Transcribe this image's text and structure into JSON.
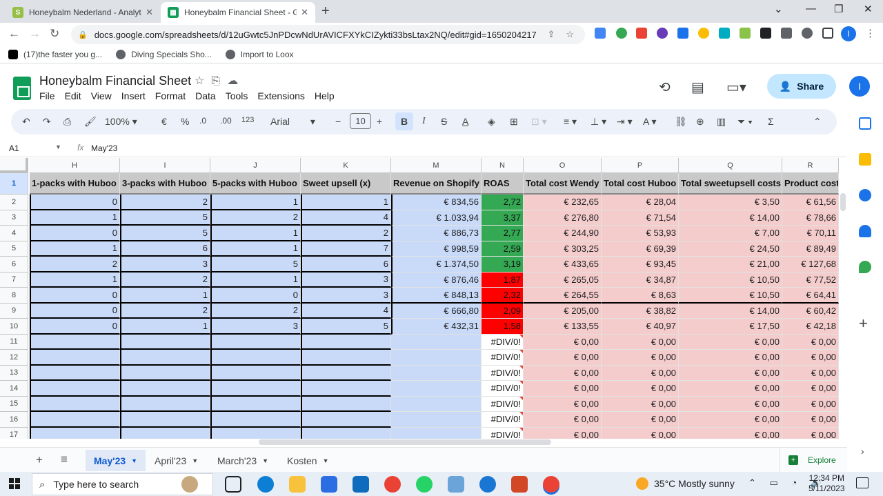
{
  "browser": {
    "tabs": [
      {
        "title": "Honeybalm Nederland - Analytics",
        "close": "✕"
      },
      {
        "title": "Honeybalm Financial Sheet - Google Sheets",
        "close": "✕"
      }
    ],
    "new_tab": "+",
    "url": "docs.google.com/spreadsheets/d/12uGwtc5JnPDcwNdUrAVICFXYkCIZykti33bsLtax2NQ/edit#gid=1650204217",
    "profile_initial": "I",
    "bookmarks": [
      "(17)the faster you g...",
      "Diving Specials Sho...",
      "Import to Loox"
    ]
  },
  "sheets": {
    "title": "Honeybalm Financial Sheet",
    "menus": [
      "File",
      "Edit",
      "View",
      "Insert",
      "Format",
      "Data",
      "Tools",
      "Extensions",
      "Help"
    ],
    "share_label": "Share",
    "account_initial": "I",
    "toolbar": {
      "zoom": "100%",
      "currency": "€",
      "percent": "%",
      "dec_decrease": ".0",
      "dec_increase": ".00",
      "number_format": "123",
      "font": "Arial",
      "font_size": "10",
      "bold": "B",
      "italic": "I"
    },
    "formula_bar": {
      "cell_ref": "A1",
      "fx": "fx",
      "value": "May'23"
    },
    "columns": [
      "H",
      "I",
      "J",
      "K",
      "M",
      "N",
      "O",
      "P",
      "Q",
      "R"
    ],
    "row_numbers": [
      "1",
      "2",
      "3",
      "4",
      "5",
      "6",
      "7",
      "8",
      "9",
      "10",
      "11",
      "12",
      "13",
      "14",
      "15",
      "16",
      "17"
    ],
    "headers": [
      "1-packs with Huboo",
      "3-packs with Huboo",
      "5-packs with Huboo",
      "Sweet upsell (x)",
      "Revenue on Shopify",
      "ROAS",
      "Total cost Wendy",
      "Total cost Huboo",
      "Total sweetupsell costs",
      "Product cost"
    ],
    "rows": [
      [
        "0",
        "2",
        "1",
        "1",
        "€ 834,56",
        "2,72",
        "€ 232,65",
        "€ 28,04",
        "€ 3,50",
        "€ 61,56"
      ],
      [
        "1",
        "5",
        "2",
        "4",
        "€ 1.033,94",
        "3,37",
        "€ 276,80",
        "€ 71,54",
        "€ 14,00",
        "€ 78,66"
      ],
      [
        "0",
        "5",
        "1",
        "2",
        "€ 886,73",
        "2,77",
        "€ 244,90",
        "€ 53,93",
        "€ 7,00",
        "€ 70,11"
      ],
      [
        "1",
        "6",
        "1",
        "7",
        "€ 998,59",
        "2,59",
        "€ 303,25",
        "€ 69,39",
        "€ 24,50",
        "€ 89,49"
      ],
      [
        "2",
        "3",
        "5",
        "6",
        "€ 1.374,50",
        "3,19",
        "€ 433,65",
        "€ 93,45",
        "€ 21,00",
        "€ 127,68"
      ],
      [
        "1",
        "2",
        "1",
        "3",
        "€ 876,46",
        "1,87",
        "€ 265,05",
        "€ 34,87",
        "€ 10,50",
        "€ 77,52"
      ],
      [
        "0",
        "1",
        "0",
        "3",
        "€ 848,13",
        "2,32",
        "€ 264,55",
        "€ 8,63",
        "€ 10,50",
        "€ 64,41"
      ],
      [
        "0",
        "2",
        "2",
        "4",
        "€ 666,80",
        "2,09",
        "€ 205,00",
        "€ 38,82",
        "€ 14,00",
        "€ 60,42"
      ],
      [
        "0",
        "1",
        "3",
        "5",
        "€ 432,31",
        "1,58",
        "€ 133,55",
        "€ 40,97",
        "€ 17,50",
        "€ 42,18"
      ],
      [
        "",
        "",
        "",
        "",
        "",
        "#DIV/0!",
        "€ 0,00",
        "€ 0,00",
        "€ 0,00",
        "€ 0,00"
      ],
      [
        "",
        "",
        "",
        "",
        "",
        "#DIV/0!",
        "€ 0,00",
        "€ 0,00",
        "€ 0,00",
        "€ 0,00"
      ],
      [
        "",
        "",
        "",
        "",
        "",
        "#DIV/0!",
        "€ 0,00",
        "€ 0,00",
        "€ 0,00",
        "€ 0,00"
      ],
      [
        "",
        "",
        "",
        "",
        "",
        "#DIV/0!",
        "€ 0,00",
        "€ 0,00",
        "€ 0,00",
        "€ 0,00"
      ],
      [
        "",
        "",
        "",
        "",
        "",
        "#DIV/0!",
        "€ 0,00",
        "€ 0,00",
        "€ 0,00",
        "€ 0,00"
      ],
      [
        "",
        "",
        "",
        "",
        "",
        "#DIV/0!",
        "€ 0,00",
        "€ 0,00",
        "€ 0,00",
        "€ 0,00"
      ],
      [
        "",
        "",
        "",
        "",
        "",
        "#DIV/0!",
        "€ 0,00",
        "€ 0,00",
        "€ 0,00",
        "€ 0,00"
      ]
    ],
    "roas_status": [
      "green",
      "green",
      "green",
      "green",
      "green",
      "red",
      "red",
      "red",
      "red",
      "err",
      "err",
      "err",
      "err",
      "err",
      "err",
      "err"
    ],
    "sheet_tabs": [
      "May'23",
      "April'23",
      "March'23",
      "Kosten"
    ],
    "active_sheet": "May'23",
    "explore_label": "Explore"
  },
  "colors": {
    "accent": "#1a73e8",
    "roas_good": "#34a853",
    "roas_bad": "#ff0000",
    "revenue_fill": "#c9daf8",
    "cost_fill": "#f4cccc"
  },
  "taskbar": {
    "search_placeholder": "Type here to search",
    "weather": "35°C  Mostly sunny",
    "time": "12:34 PM",
    "date": "5/11/2023"
  }
}
